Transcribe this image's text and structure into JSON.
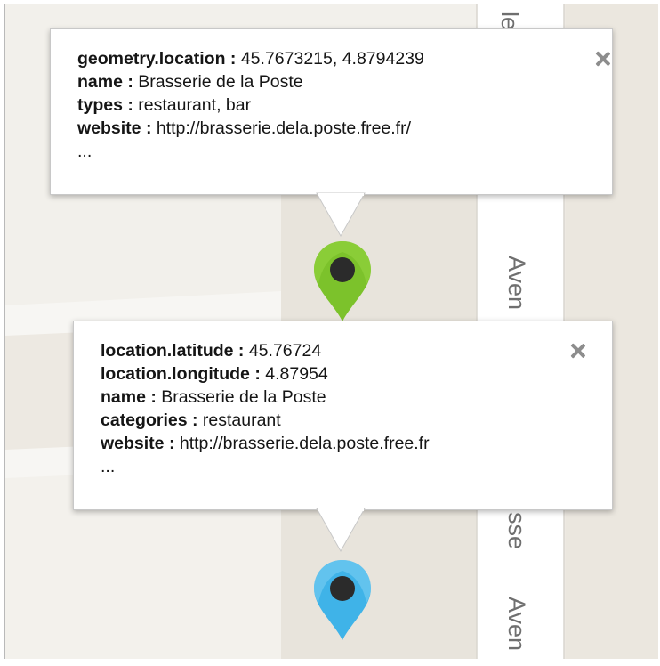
{
  "map": {
    "streets": {
      "top_label": "le",
      "middle_label": "Aven",
      "lower_label": "sse",
      "bottom_label": "Aven"
    },
    "colors": {
      "background": "#ede9e2",
      "block_light": "#f2f0eb",
      "road": "#ffffff",
      "street_label": "#6f6f6f"
    }
  },
  "info_window_1": {
    "lines": [
      {
        "key": "geometry.location :",
        "value": " 45.7673215, 4.8794239"
      },
      {
        "key": "name :",
        "value": " Brasserie de la Poste"
      },
      {
        "key": "types :",
        "value": " restaurant, bar"
      },
      {
        "key": "website :",
        "value": " http://brasserie.dela.poste.free.fr/"
      }
    ],
    "ellipsis": "...",
    "close_glyph": "×"
  },
  "info_window_2": {
    "lines": [
      {
        "key": "location.latitude :",
        "value": " 45.76724"
      },
      {
        "key": "location.longitude :",
        "value": " 4.87954"
      },
      {
        "key": "name :",
        "value": " Brasserie de la Poste"
      },
      {
        "key": "categories :",
        "value": " restaurant"
      },
      {
        "key": "website :",
        "value": " http://brasserie.dela.poste.free.fr"
      }
    ],
    "ellipsis": "...",
    "close_glyph": "×"
  },
  "markers": {
    "green": {
      "name": "green-map-marker",
      "color": "#7cc22b",
      "dot": "#2b2b2b"
    },
    "blue": {
      "name": "blue-map-marker",
      "color": "#3fb3e8",
      "dot": "#2b2b2b"
    }
  }
}
